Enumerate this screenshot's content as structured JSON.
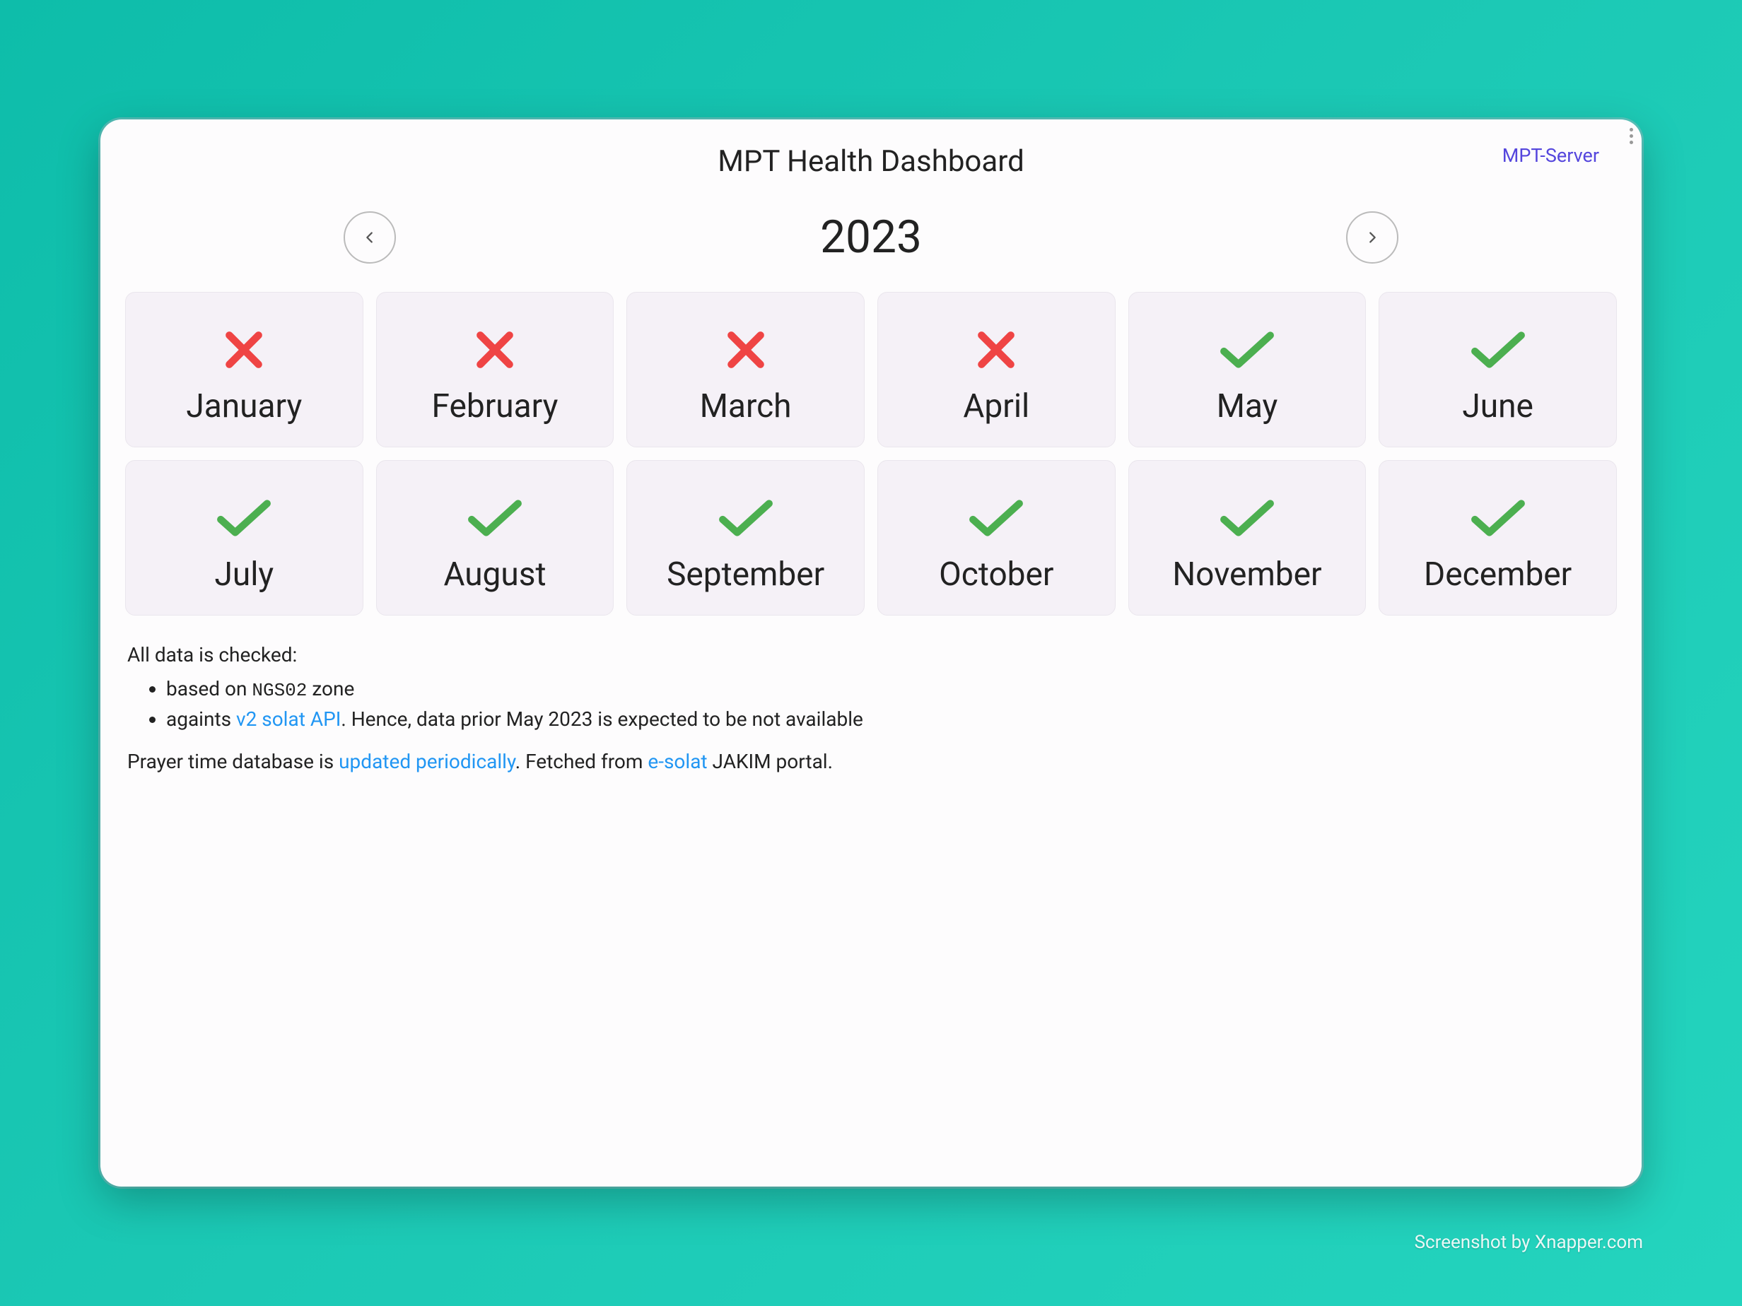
{
  "header": {
    "title": "MPT Health Dashboard",
    "link_label": "MPT-Server"
  },
  "year": "2023",
  "colors": {
    "ok": "#4caf50",
    "fail": "#ef4444"
  },
  "months": [
    {
      "name": "January",
      "status": "fail"
    },
    {
      "name": "February",
      "status": "fail"
    },
    {
      "name": "March",
      "status": "fail"
    },
    {
      "name": "April",
      "status": "fail"
    },
    {
      "name": "May",
      "status": "ok"
    },
    {
      "name": "June",
      "status": "ok"
    },
    {
      "name": "July",
      "status": "ok"
    },
    {
      "name": "August",
      "status": "ok"
    },
    {
      "name": "September",
      "status": "ok"
    },
    {
      "name": "October",
      "status": "ok"
    },
    {
      "name": "November",
      "status": "ok"
    },
    {
      "name": "December",
      "status": "ok"
    }
  ],
  "info": {
    "intro": "All data is checked:",
    "bullet1_prefix": "based on ",
    "bullet1_zone": "NGS02",
    "bullet1_suffix": " zone",
    "bullet2_prefix": "againts ",
    "bullet2_link": "v2 solat API",
    "bullet2_suffix": ". Hence, data prior May 2023 is expected to be not available",
    "line2_prefix": "Prayer time database is ",
    "line2_link1": "updated periodically",
    "line2_mid": ". Fetched from ",
    "line2_link2": "e-solat",
    "line2_suffix": " JAKIM portal."
  },
  "footer_credit": "Screenshot by Xnapper.com"
}
